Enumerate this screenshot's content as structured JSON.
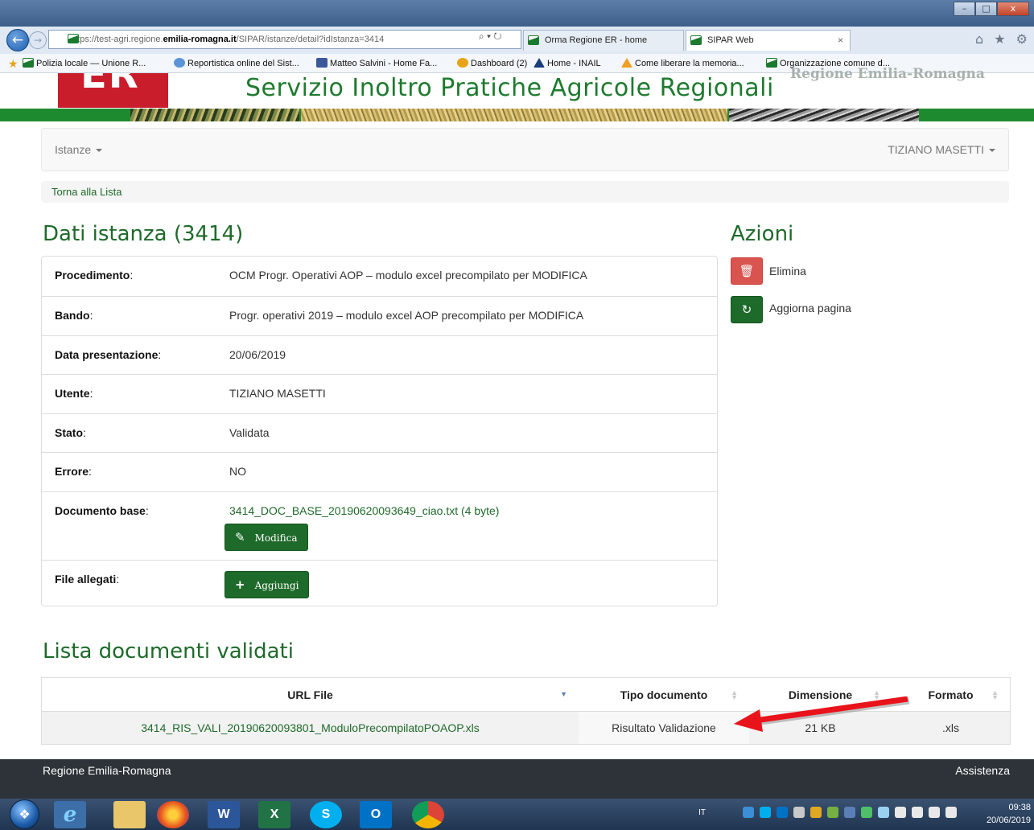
{
  "browser": {
    "address_prefix": "https://test-agri.regione.",
    "address_strong": "emilia-romagna.it",
    "address_suffix": "/SIPAR/istanze/detail?idIstanza=3414",
    "address_tools": "⌕ ▾ ↻",
    "tabs": [
      {
        "label": "Orma Regione ER - home"
      },
      {
        "label": "SIPAR Web",
        "close": "×"
      }
    ],
    "right_icons": "⌂ ★ ⚙",
    "window_buttons": {
      "minimize": "–",
      "maximize": "□",
      "close": "x"
    }
  },
  "favorites": [
    {
      "label": "Polizia locale — Unione R...",
      "icon": "er-flag-icon"
    },
    {
      "label": "Reportistica online del Sist...",
      "icon": "ie-page-icon"
    },
    {
      "label": "Matteo Salvini - Home Fa...",
      "icon": "facebook-icon"
    },
    {
      "label": "Dashboard (2)",
      "icon": "dashboard-icon"
    },
    {
      "label": "Home - INAIL",
      "icon": "inail-icon"
    },
    {
      "label": "Come liberare la memoria...",
      "icon": "acrobat-icon"
    },
    {
      "label": "Organizzazione comune d...",
      "icon": "er-flag-icon"
    }
  ],
  "site": {
    "title": "Servizio Inoltro Pratiche Agricole Regionali",
    "region_ghost": "Regione Emilia-Romagna"
  },
  "navbar": {
    "menu": "Istanze",
    "user": "TIZIANO MASETTI"
  },
  "breadcrumb": {
    "back_link": "Torna alla Lista"
  },
  "detail": {
    "heading": "Dati istanza (3414)",
    "rows": [
      {
        "label": "Procedimento",
        "value": "OCM Progr. Operativi AOP – modulo excel precompilato per MODIFICA"
      },
      {
        "label": "Bando",
        "value": "Progr. operativi 2019 – modulo excel AOP precompilato per MODIFICA"
      },
      {
        "label": "Data presentazione",
        "value": "20/06/2019"
      },
      {
        "label": "Utente",
        "value": "TIZIANO MASETTI"
      },
      {
        "label": "Stato",
        "value": "Validata"
      },
      {
        "label": "Errore",
        "value": "NO"
      },
      {
        "label": "Documento base",
        "value": "3414_DOC_BASE_20190620093649_ciao.txt (4 byte)",
        "button": "Modifica"
      },
      {
        "label": "File allegati",
        "button": "Aggiungi"
      }
    ]
  },
  "actions": {
    "heading": "Azioni",
    "delete": "Elimina",
    "refresh": "Aggiorna pagina"
  },
  "validated": {
    "heading": "Lista documenti validati",
    "columns": [
      "URL File",
      "Tipo documento",
      "Dimensione",
      "Formato"
    ],
    "rows": [
      {
        "url": "3414_RIS_VALI_20190620093801_ModuloPrecompilatoPOAOP.xls",
        "type": "Risultato Validazione",
        "size": "21 KB",
        "format": ".xls"
      }
    ]
  },
  "footer": {
    "left": "Regione Emilia-Romagna",
    "right": "Assistenza"
  },
  "taskbar": {
    "apps": [
      "windows-start",
      "internet-explorer",
      "file-explorer",
      "firefox",
      "word",
      "excel",
      "skype",
      "outlook",
      "chrome"
    ],
    "language": "IT",
    "time": "09:38",
    "date": "20/06/2019"
  },
  "colors": {
    "brand_green": "#1e6a2a",
    "danger_red": "#d9534f",
    "annotation_arrow": "#e8131b"
  }
}
